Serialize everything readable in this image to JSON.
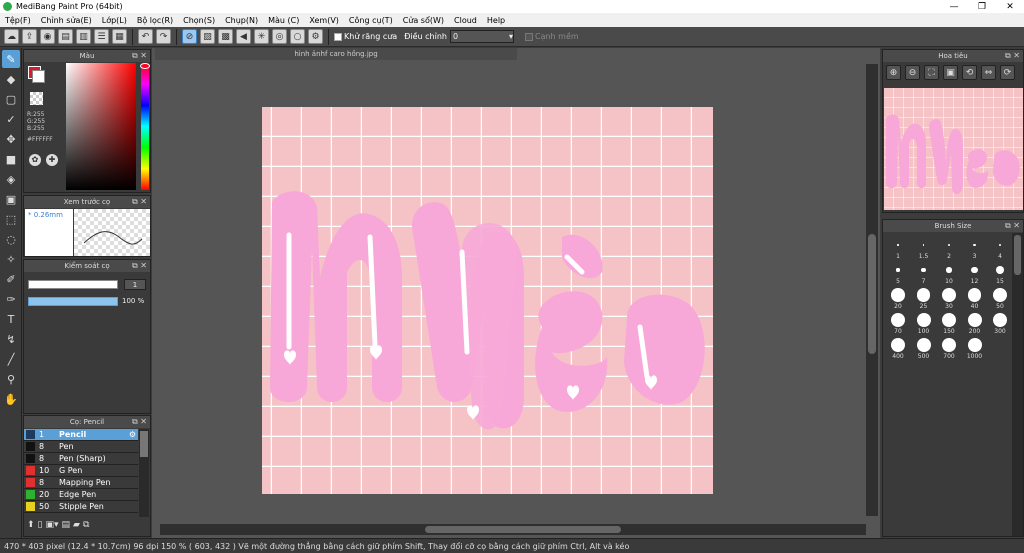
{
  "window": {
    "title": "MediBang Paint Pro (64bit)",
    "min": "—",
    "max": "❐",
    "close": "✕"
  },
  "menu": [
    "Tệp(F)",
    "Chỉnh sửa(E)",
    "Lớp(L)",
    "Bộ lọc(R)",
    "Chọn(S)",
    "Chụp(N)",
    "Màu (C)",
    "Xem(V)",
    "Công cụ(T)",
    "Cửa sổ(W)",
    "Cloud",
    "Help"
  ],
  "toolbar": {
    "antialias_label": "Khử răng cưa",
    "adjust_label": "Điều chỉnh",
    "adjust_value": "0",
    "soft_edge_label": "Cạnh mềm"
  },
  "color_panel": {
    "title": "Màu",
    "r": "R:255",
    "g": "G:255",
    "b": "B:255",
    "hex": "#FFFFFF",
    "fg_color": "#ffffff",
    "bg_color": "#d81b2f"
  },
  "brush_preview": {
    "title": "Xem trước cọ",
    "size": "* 0.26mm"
  },
  "brush_control": {
    "title": "Kiểm soát cọ",
    "size_value": "1",
    "opacity_value": "100 %"
  },
  "brush_list": {
    "title": "Cọ: Pencil",
    "items": [
      {
        "size": "1",
        "name": "Pencil",
        "color": "#1e3a5f"
      },
      {
        "size": "8",
        "name": "Pen",
        "color": "#111111"
      },
      {
        "size": "8",
        "name": "Pen (Sharp)",
        "color": "#111111"
      },
      {
        "size": "10",
        "name": "G Pen",
        "color": "#e03030"
      },
      {
        "size": "8",
        "name": "Mapping Pen",
        "color": "#e03030"
      },
      {
        "size": "20",
        "name": "Edge Pen",
        "color": "#30b030"
      },
      {
        "size": "50",
        "name": "Stipple Pen",
        "color": "#e8d020"
      }
    ]
  },
  "document": {
    "tab": "hình ảnhf caro hồng.jpg"
  },
  "navigator": {
    "title": "Hoa tiêu"
  },
  "brush_size": {
    "title": "Brush Size",
    "sizes": [
      "1",
      "1.5",
      "2",
      "3",
      "4",
      "5",
      "7",
      "10",
      "12",
      "15",
      "20",
      "25",
      "30",
      "40",
      "50",
      "70",
      "100",
      "150",
      "200",
      "300",
      "400",
      "500",
      "700",
      "1000"
    ]
  },
  "status": {
    "text": "470 * 403 pixel   (12.4 * 10.7cm)   96 dpi   150 %   ( 603, 432 )   Vẽ một đường thẳng bằng cách giữ phím Shift, Thay đổi cỡ cọ bằng cách giữ phím Ctrl, Alt và kéo"
  },
  "colors": {
    "canvas_pink": "#f5c2c5",
    "letters_pink": "#f7a8d8",
    "accent_blue": "#5a9fd6"
  }
}
